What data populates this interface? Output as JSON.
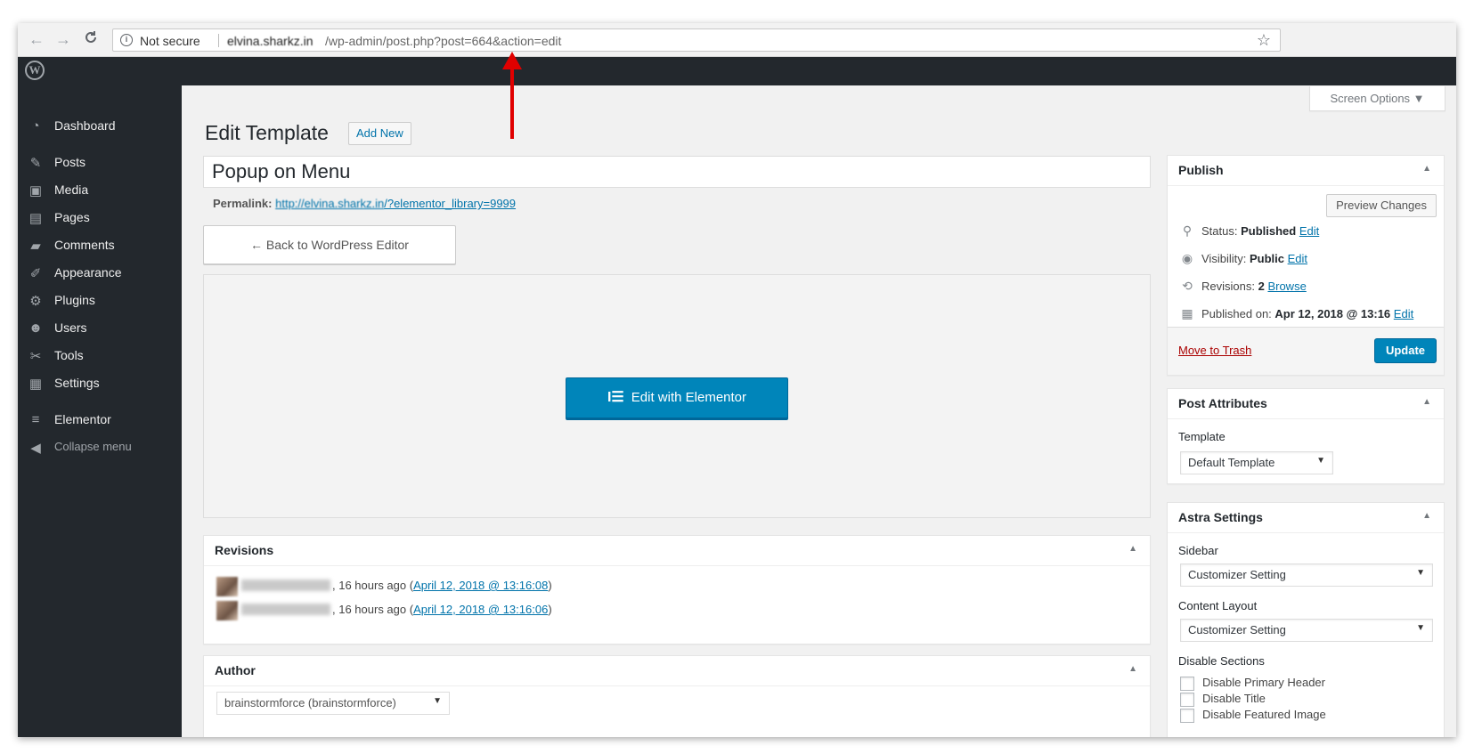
{
  "browser": {
    "back_icon": "←",
    "forward_icon": "→",
    "reload_icon": "C",
    "info_icon": "i",
    "security_label": "Not secure",
    "url_host": "elvina.sharkz.in",
    "url_path": "/wp-admin/post.php?post=664&action=edit",
    "star_icon": "☆"
  },
  "admin_bar": {
    "logo": "W"
  },
  "sidebar": {
    "items": [
      {
        "label": "Dashboard",
        "icon": "◔"
      },
      {
        "label": "Posts",
        "icon": "✎"
      },
      {
        "label": "Media",
        "icon": "▣"
      },
      {
        "label": "Pages",
        "icon": "▤"
      },
      {
        "label": "Comments",
        "icon": "▰"
      },
      {
        "label": "Appearance",
        "icon": "✐"
      },
      {
        "label": "Plugins",
        "icon": "⚙"
      },
      {
        "label": "Users",
        "icon": "☻"
      },
      {
        "label": "Tools",
        "icon": "✂"
      },
      {
        "label": "Settings",
        "icon": "▦"
      },
      {
        "label": "Elementor",
        "icon": "≡"
      }
    ],
    "collapse_label": "Collapse menu",
    "collapse_icon": "◀"
  },
  "header": {
    "screen_options": "Screen Options ▼",
    "page_title": "Edit Template",
    "add_new": "Add New"
  },
  "editor": {
    "title_value": "Popup on Menu",
    "permalink_label": "Permalink:",
    "permalink_host": "http://elvina.sharkz.in",
    "permalink_path": "/?elementor_library=9999",
    "back_button": "← Back to WordPress Editor",
    "elementor_icon": "I☰",
    "elementor_button": "Edit with Elementor"
  },
  "revisions": {
    "title": "Revisions",
    "toggle": "▲",
    "rows": [
      {
        "prefix": ", 16 hours ago (",
        "link": "April 12, 2018 @ 13:16:08",
        "suffix": ")"
      },
      {
        "prefix": ", 16 hours ago (",
        "link": "April 12, 2018 @ 13:16:06",
        "suffix": ")"
      }
    ]
  },
  "author": {
    "title": "Author",
    "toggle": "▲",
    "selected": "brainstormforce (brainstormforce)",
    "caret": "▼"
  },
  "publish": {
    "title": "Publish",
    "toggle": "▲",
    "preview_button": "Preview Changes",
    "status_icon": "📍",
    "status_label": "Status:",
    "status_value": "Published",
    "visibility_icon": "◉",
    "visibility_label": "Visibility:",
    "visibility_value": "Public",
    "revisions_icon": "⟲",
    "revisions_label": "Revisions:",
    "revisions_value": "2",
    "browse_link": "Browse",
    "published_icon": "▦",
    "published_label": "Published on:",
    "published_value": "Apr 12, 2018 @ 13:16",
    "edit_link": "Edit",
    "trash_link": "Move to Trash",
    "update_button": "Update"
  },
  "post_attributes": {
    "title": "Post Attributes",
    "toggle": "▲",
    "template_label": "Template",
    "template_selected": "Default Template",
    "caret": "▼"
  },
  "astra": {
    "title": "Astra Settings",
    "toggle": "▲",
    "sidebar_label": "Sidebar",
    "sidebar_selected": "Customizer Setting",
    "content_layout_label": "Content Layout",
    "content_layout_selected": "Customizer Setting",
    "caret": "▼",
    "disable_sections_label": "Disable Sections",
    "checkboxes": [
      "Disable Primary Header",
      "Disable Title",
      "Disable Featured Image"
    ]
  },
  "colors": {
    "admin_dark": "#23282d",
    "primary_blue": "#0085ba",
    "link_blue": "#0073aa",
    "trash_red": "#aa0000",
    "annotation_red": "#e00000"
  }
}
